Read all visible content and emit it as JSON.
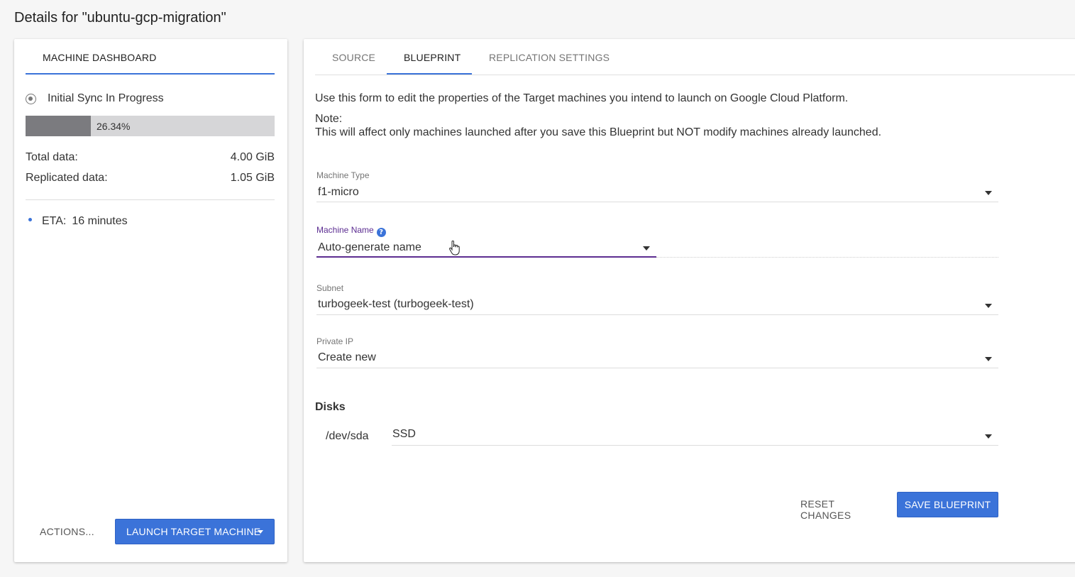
{
  "page": {
    "title": "Details for \"ubuntu-gcp-migration\""
  },
  "left_panel": {
    "tab_label": "MACHINE DASHBOARD",
    "sync_status": "Initial Sync In Progress",
    "progress_text": "26.34%",
    "progress_fraction": 0.2634,
    "total_data_label": "Total data:",
    "total_data_value": "4.00 GiB",
    "replicated_data_label": "Replicated data:",
    "replicated_data_value": "1.05 GiB",
    "eta_label": "ETA:",
    "eta_value": "16 minutes",
    "actions_label": "ACTIONS...",
    "launch_label": "LAUNCH TARGET MACHINE"
  },
  "right_panel": {
    "tabs": [
      {
        "label": "SOURCE",
        "active": false
      },
      {
        "label": "BLUEPRINT",
        "active": true
      },
      {
        "label": "REPLICATION SETTINGS",
        "active": false
      }
    ],
    "intro": "Use this form to edit the properties of the Target machines you intend to launch on Google Cloud Platform.",
    "note_heading": "Note:",
    "note_text": "This will affect only machines launched after you save this Blueprint but NOT modify machines already launched.",
    "fields": {
      "machine_type": {
        "label": "Machine Type",
        "value": "f1-micro"
      },
      "machine_name": {
        "label": "Machine Name",
        "value": "Auto-generate name",
        "help": "?"
      },
      "subnet": {
        "label": "Subnet",
        "value": "turbogeek-test (turbogeek-test)"
      },
      "private_ip": {
        "label": "Private IP",
        "value": "Create new"
      }
    },
    "disks_heading": "Disks",
    "disks": [
      {
        "name": "/dev/sda",
        "type": "SSD"
      }
    ],
    "reset_label": "RESET CHANGES",
    "save_label": "SAVE BLUEPRINT"
  },
  "colors": {
    "accent": "#3b73d9",
    "focus": "#5c2d91",
    "progress_fill": "#7b7b7f",
    "progress_track": "#d6d6d8"
  },
  "icons": {
    "sync": "sync-progress-icon",
    "help": "help-icon",
    "caret": "chevron-down-icon",
    "cursor": "hand-pointer-cursor-icon"
  }
}
